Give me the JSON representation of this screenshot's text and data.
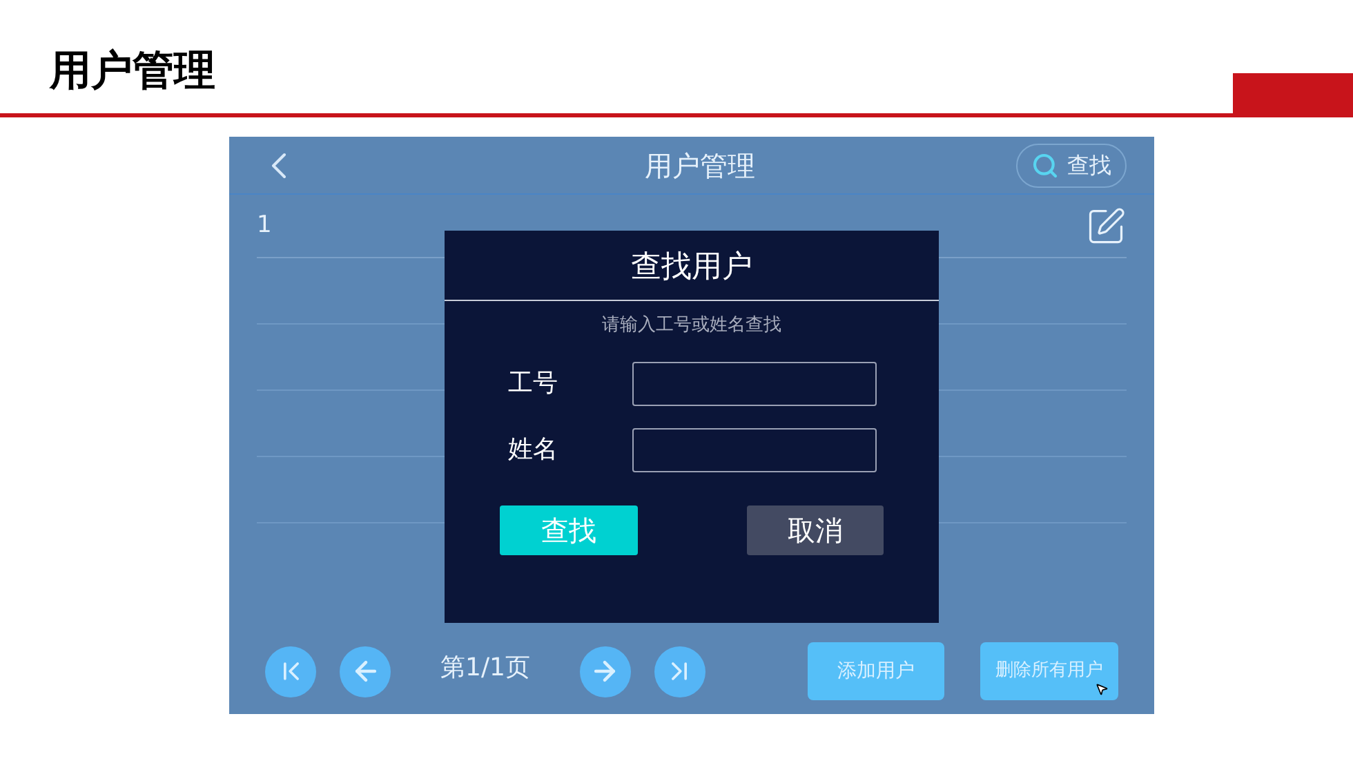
{
  "slide": {
    "title": "用户管理"
  },
  "screen": {
    "header": {
      "title": "用户管理",
      "search_button": "查找"
    },
    "rows": [
      {
        "number": "1"
      }
    ],
    "pager": {
      "page_label": "第1/1页"
    },
    "buttons": [
      "添加用户",
      "删除所有用户"
    ]
  },
  "dialog": {
    "title": "查找用户",
    "hint": "请输入工号或姓名查找",
    "fields": [
      {
        "label": "工号"
      },
      {
        "label": "姓名"
      }
    ],
    "confirm": "查找",
    "cancel": "取消"
  }
}
